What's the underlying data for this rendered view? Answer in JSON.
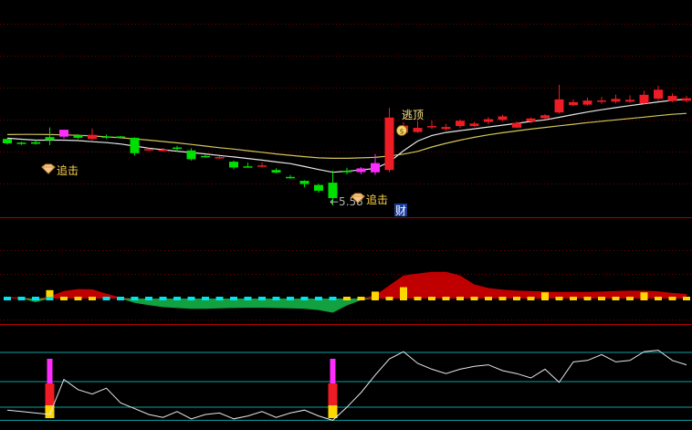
{
  "colors": {
    "background": "#000000",
    "up": "#ee1c24",
    "down": "#00e000",
    "doji_up": "#ff2cff",
    "ma_fast": "#e8e8e8",
    "ma_slow": "#d4c65a",
    "divider": "#b00000",
    "grid": "#7a0000",
    "osc_pos": "#c00000",
    "osc_neg": "#12a040",
    "osc_dash_cyan": "#00e5ee",
    "osc_dash_yellow": "#ffd700",
    "ref_line": "#10a0a0",
    "osc_line": "#e8e8e8",
    "annotation_text": "#ffd54a",
    "sell_text": "#ffe98a",
    "cai_badge_bg": "#1a3d9a",
    "cai_badge_text": "#ffffff",
    "arrow_text": "#b0b0b0"
  },
  "icons": {
    "buy_marker": "gem-icon",
    "sell_marker": "money-bag-icon"
  },
  "annotations": {
    "buy_signal_1": "追击",
    "buy_signal_2": "追击",
    "price_arrow": "←5.58",
    "sell_signal": "逃顶",
    "cai_badge": "财"
  },
  "chart_data": [
    {
      "type": "candlestick",
      "panel": "price",
      "legend": "none",
      "grid": true,
      "candles": [
        {
          "o": 0.3,
          "h": 0.306,
          "l": 0.252,
          "c": 0.262
        },
        {
          "o": 0.268,
          "h": 0.276,
          "l": 0.248,
          "c": 0.256
        },
        {
          "o": 0.272,
          "h": 0.29,
          "l": 0.25,
          "c": 0.258
        },
        {
          "o": 0.316,
          "h": 0.4,
          "l": 0.246,
          "c": 0.29
        },
        {
          "o": 0.32,
          "h": 0.352,
          "l": 0.304,
          "c": 0.38
        },
        {
          "o": 0.332,
          "h": 0.342,
          "l": 0.3,
          "c": 0.31
        },
        {
          "o": 0.3,
          "h": 0.39,
          "l": 0.288,
          "c": 0.336
        },
        {
          "o": 0.322,
          "h": 0.338,
          "l": 0.3,
          "c": 0.318
        },
        {
          "o": 0.322,
          "h": 0.326,
          "l": 0.31,
          "c": 0.318
        },
        {
          "o": 0.31,
          "h": 0.314,
          "l": 0.156,
          "c": 0.176
        },
        {
          "o": 0.206,
          "h": 0.22,
          "l": 0.194,
          "c": 0.212
        },
        {
          "o": 0.198,
          "h": 0.222,
          "l": 0.19,
          "c": 0.206
        },
        {
          "o": 0.226,
          "h": 0.24,
          "l": 0.19,
          "c": 0.214
        },
        {
          "o": 0.2,
          "h": 0.218,
          "l": 0.112,
          "c": 0.124
        },
        {
          "o": 0.152,
          "h": 0.16,
          "l": 0.138,
          "c": 0.15
        },
        {
          "o": 0.136,
          "h": 0.152,
          "l": 0.13,
          "c": 0.142
        },
        {
          "o": 0.102,
          "h": 0.112,
          "l": 0.036,
          "c": 0.052
        },
        {
          "o": 0.062,
          "h": 0.094,
          "l": 0.052,
          "c": 0.06
        },
        {
          "o": 0.06,
          "h": 0.098,
          "l": 0.05,
          "c": 0.07
        },
        {
          "o": 0.03,
          "h": 0.046,
          "l": 0.002,
          "c": 0.008
        },
        {
          "o": -0.03,
          "h": -0.014,
          "l": -0.046,
          "c": -0.04
        },
        {
          "o": -0.064,
          "h": -0.06,
          "l": -0.12,
          "c": -0.092
        },
        {
          "o": -0.1,
          "h": -0.09,
          "l": -0.168,
          "c": -0.15
        },
        {
          "o": -0.08,
          "h": 0.026,
          "l": -0.278,
          "c": -0.214
        },
        {
          "o": 0.024,
          "h": 0.05,
          "l": -0.008,
          "c": 0.01
        },
        {
          "o": 0.012,
          "h": 0.056,
          "l": -0.006,
          "c": 0.044
        },
        {
          "o": 0.01,
          "h": 0.17,
          "l": -0.012,
          "c": 0.09
        },
        {
          "o": 0.03,
          "h": 0.57,
          "l": 0.01,
          "c": 0.486
        },
        {
          "o": 0.354,
          "h": 0.444,
          "l": 0.34,
          "c": 0.416
        },
        {
          "o": 0.36,
          "h": 0.456,
          "l": 0.352,
          "c": 0.396
        },
        {
          "o": 0.402,
          "h": 0.46,
          "l": 0.384,
          "c": 0.412
        },
        {
          "o": 0.386,
          "h": 0.432,
          "l": 0.372,
          "c": 0.404
        },
        {
          "o": 0.412,
          "h": 0.47,
          "l": 0.394,
          "c": 0.458
        },
        {
          "o": 0.412,
          "h": 0.448,
          "l": 0.406,
          "c": 0.434
        },
        {
          "o": 0.448,
          "h": 0.49,
          "l": 0.428,
          "c": 0.472
        },
        {
          "o": 0.466,
          "h": 0.51,
          "l": 0.456,
          "c": 0.496
        },
        {
          "o": 0.398,
          "h": 0.452,
          "l": 0.396,
          "c": 0.44
        },
        {
          "o": 0.452,
          "h": 0.486,
          "l": 0.438,
          "c": 0.478
        },
        {
          "o": 0.48,
          "h": 0.516,
          "l": 0.47,
          "c": 0.506
        },
        {
          "o": 0.53,
          "h": 0.77,
          "l": 0.52,
          "c": 0.644
        },
        {
          "o": 0.594,
          "h": 0.644,
          "l": 0.584,
          "c": 0.62
        },
        {
          "o": 0.598,
          "h": 0.66,
          "l": 0.59,
          "c": 0.634
        },
        {
          "o": 0.632,
          "h": 0.666,
          "l": 0.606,
          "c": 0.634
        },
        {
          "o": 0.624,
          "h": 0.686,
          "l": 0.61,
          "c": 0.648
        },
        {
          "o": 0.624,
          "h": 0.68,
          "l": 0.614,
          "c": 0.64
        },
        {
          "o": 0.61,
          "h": 0.72,
          "l": 0.6,
          "c": 0.684
        },
        {
          "o": 0.65,
          "h": 0.762,
          "l": 0.632,
          "c": 0.728
        },
        {
          "o": 0.63,
          "h": 0.696,
          "l": 0.62,
          "c": 0.674
        },
        {
          "o": 0.632,
          "h": 0.676,
          "l": 0.618,
          "c": 0.654
        }
      ],
      "ma_fast": [
        0.306,
        0.298,
        0.29,
        0.29,
        0.29,
        0.286,
        0.276,
        0.268,
        0.256,
        0.238,
        0.22,
        0.206,
        0.194,
        0.182,
        0.17,
        0.156,
        0.144,
        0.13,
        0.116,
        0.1,
        0.086,
        0.06,
        0.034,
        0.01,
        0.02,
        0.03,
        0.044,
        0.1,
        0.198,
        0.282,
        0.33,
        0.356,
        0.372,
        0.388,
        0.404,
        0.42,
        0.436,
        0.452,
        0.466,
        0.488,
        0.512,
        0.534,
        0.554,
        0.572,
        0.59,
        0.606,
        0.622,
        0.636,
        0.646
      ],
      "ma_slow": [
        0.338,
        0.34,
        0.34,
        0.338,
        0.336,
        0.332,
        0.326,
        0.318,
        0.31,
        0.3,
        0.29,
        0.278,
        0.266,
        0.252,
        0.238,
        0.224,
        0.212,
        0.198,
        0.184,
        0.17,
        0.158,
        0.146,
        0.136,
        0.132,
        0.132,
        0.136,
        0.14,
        0.152,
        0.168,
        0.192,
        0.23,
        0.262,
        0.29,
        0.314,
        0.336,
        0.354,
        0.37,
        0.386,
        0.4,
        0.414,
        0.428,
        0.442,
        0.454,
        0.466,
        0.478,
        0.49,
        0.502,
        0.514,
        0.522
      ]
    },
    {
      "type": "area",
      "panel": "oscillator",
      "legend": "none",
      "values": [
        0.1,
        0.06,
        -0.22,
        0.12,
        0.46,
        0.58,
        0.56,
        0.3,
        0.06,
        -0.26,
        -0.4,
        -0.52,
        -0.58,
        -0.62,
        -0.62,
        -0.6,
        -0.58,
        -0.56,
        -0.56,
        -0.58,
        -0.6,
        -0.62,
        -0.7,
        -0.86,
        -0.42,
        -0.1,
        0.2,
        0.8,
        1.4,
        1.52,
        1.62,
        1.62,
        1.4,
        0.86,
        0.64,
        0.54,
        0.48,
        0.46,
        0.42,
        0.4,
        0.4,
        0.4,
        0.42,
        0.46,
        0.48,
        0.48,
        0.44,
        0.34,
        0.28
      ],
      "dash_colors": [
        "cyan",
        "cyan",
        "cyan",
        "cyan",
        "yellow",
        "yellow",
        "yellow",
        "cyan",
        "cyan",
        "cyan",
        "cyan",
        "cyan",
        "cyan",
        "cyan",
        "cyan",
        "cyan",
        "cyan",
        "cyan",
        "cyan",
        "cyan",
        "cyan",
        "cyan",
        "cyan",
        "cyan",
        "yellow",
        "yellow",
        "yellow",
        "yellow",
        "yellow",
        "yellow",
        "yellow",
        "yellow",
        "yellow",
        "yellow",
        "yellow",
        "yellow",
        "yellow",
        "yellow",
        "yellow",
        "yellow",
        "yellow",
        "yellow",
        "yellow",
        "yellow",
        "yellow",
        "yellow",
        "yellow",
        "yellow",
        "yellow"
      ],
      "bars": [
        {
          "i": 3,
          "v": 0.9
        },
        {
          "i": 26,
          "v": 0.7
        },
        {
          "i": 28,
          "v": 1.3
        },
        {
          "i": 38,
          "v": 0.6
        },
        {
          "i": 45,
          "v": 0.6
        }
      ]
    },
    {
      "type": "line",
      "panel": "indicator",
      "legend": "none",
      "values": [
        0.16,
        0.14,
        0.12,
        0.1,
        0.58,
        0.44,
        0.38,
        0.46,
        0.26,
        0.18,
        0.1,
        0.06,
        0.14,
        0.04,
        0.1,
        0.12,
        0.04,
        0.08,
        0.14,
        0.06,
        0.12,
        0.16,
        0.08,
        0.02,
        0.2,
        0.4,
        0.64,
        0.86,
        0.96,
        0.8,
        0.72,
        0.66,
        0.72,
        0.76,
        0.78,
        0.7,
        0.66,
        0.6,
        0.72,
        0.54,
        0.82,
        0.84,
        0.92,
        0.82,
        0.84,
        0.96,
        0.98,
        0.84,
        0.78
      ],
      "ref_levels": [
        0.95,
        0.55,
        0.2,
        0.02
      ],
      "signal_columns": [
        3,
        23
      ]
    }
  ]
}
